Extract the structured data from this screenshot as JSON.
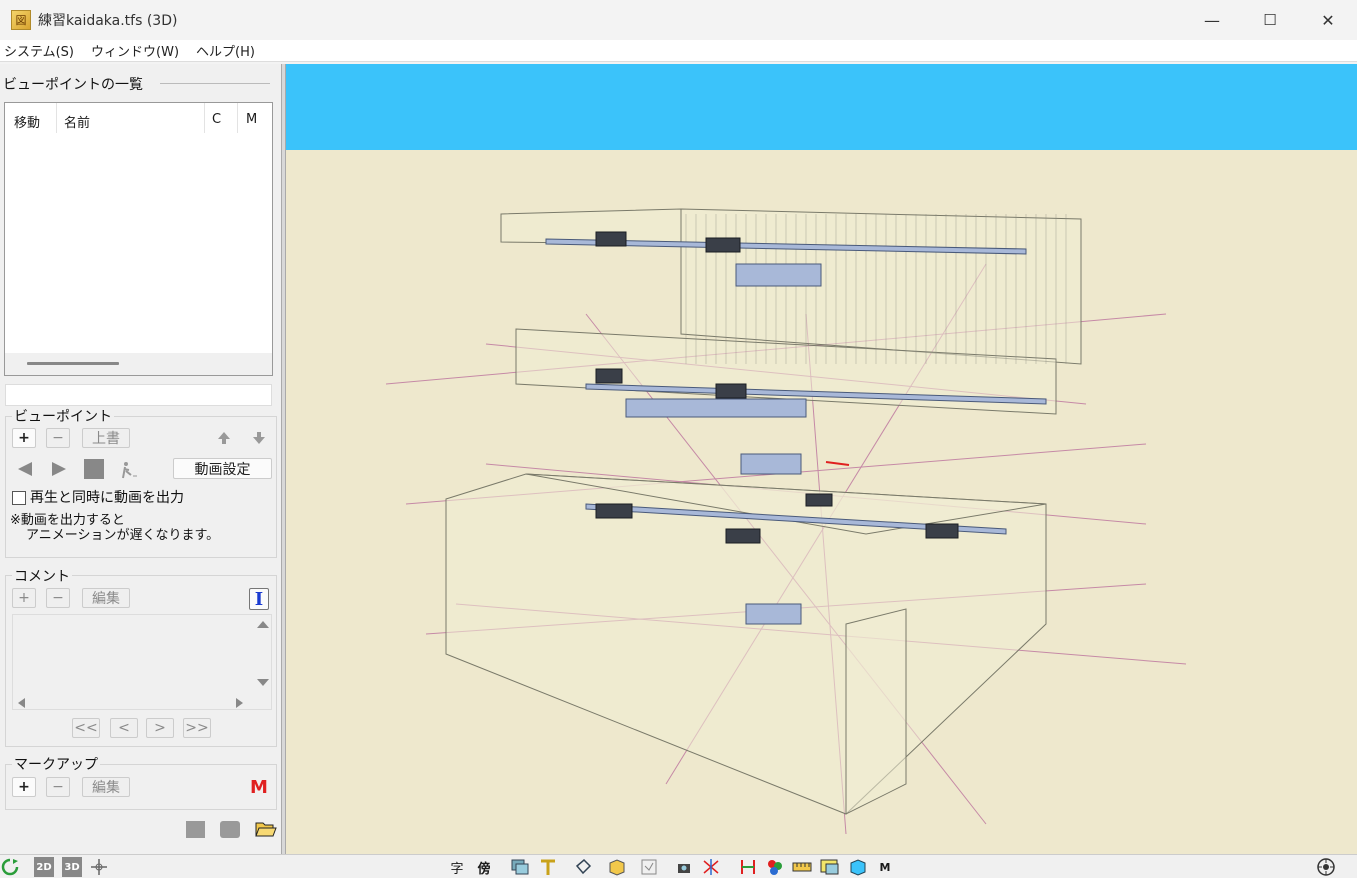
{
  "window": {
    "title": "練習kaidaka.tfs (3D)",
    "minimize": "—",
    "maximize": "☐",
    "close": "✕"
  },
  "menu": [
    {
      "label": "システム(S)"
    },
    {
      "label": "ウィンドウ(W)"
    },
    {
      "label": "ヘルプ(H)"
    }
  ],
  "viewpoint_list": {
    "title": "ビューポイントの一覧",
    "columns": {
      "move": "移動",
      "name": "名前",
      "c": "C",
      "m": "M"
    }
  },
  "viewpoint": {
    "group_label": "ビューポイント",
    "add": "+",
    "remove": "−",
    "overwrite": "上書",
    "up_icon": "arrow-up-icon",
    "down_icon": "arrow-down-icon",
    "video_settings": "動画設定",
    "output_checkbox_label": "再生と同時に動画を出力",
    "note_line1": "※動画を出力すると",
    "note_line2": "アニメーションが遅くなります。"
  },
  "comment": {
    "group_label": "コメント",
    "add": "+",
    "remove": "−",
    "edit": "編集",
    "text_icon": "I",
    "nav_first": "<<",
    "nav_prev": "<",
    "nav_next": ">",
    "nav_last": ">>"
  },
  "markup": {
    "group_label": "マークアップ",
    "add": "+",
    "remove": "−",
    "edit": "編集",
    "m_icon": "M"
  },
  "statusbar": {
    "view2d": "2D",
    "view3d": "3D",
    "icons": [
      "字",
      "傍"
    ]
  },
  "colors": {
    "sky": "#3bc3fa",
    "ground": "#eee8cd",
    "markup_red": "#e02020",
    "text_icon_blue": "#1a3bd1"
  }
}
